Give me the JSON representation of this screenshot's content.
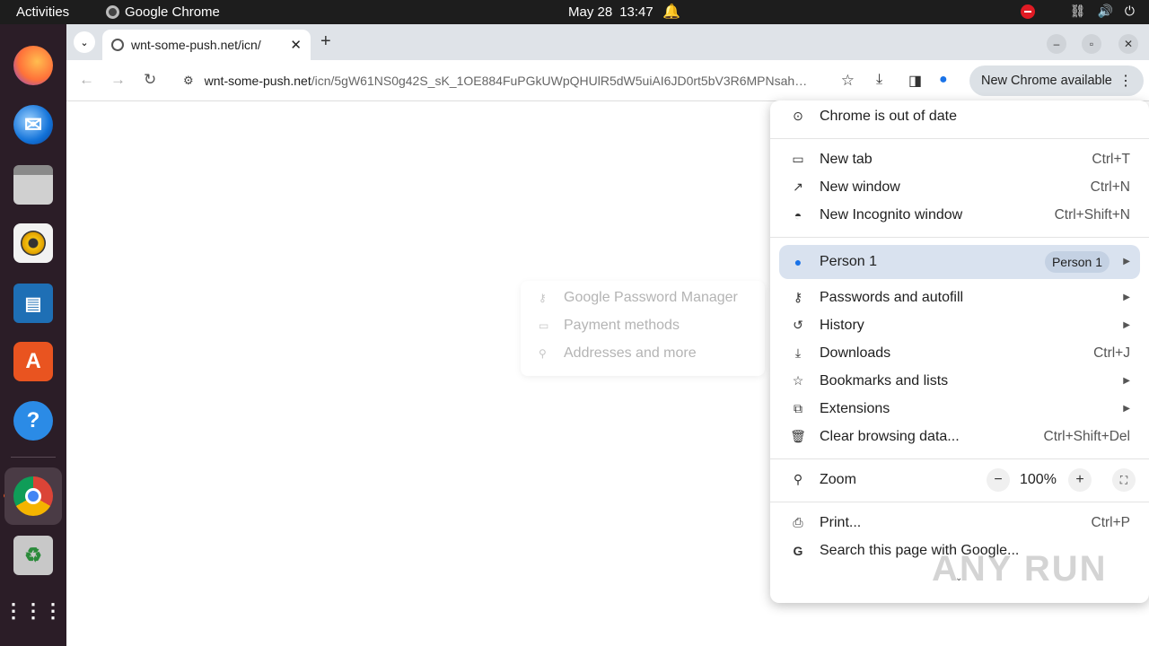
{
  "topbar": {
    "activities": "Activities",
    "app_name": "Google Chrome",
    "date": "May 28",
    "time": "13:47"
  },
  "dock": {
    "apps": [
      "firefox-icon",
      "thunderbird-icon",
      "files-icon",
      "rhythmbox-icon",
      "libreoffice-writer-icon",
      "app-center-icon",
      "help-icon",
      "chrome-icon",
      "trash-icon",
      "show-apps-icon"
    ]
  },
  "tab": {
    "title": "wnt-some-push.net/icn/"
  },
  "address": {
    "host": "wnt-some-push.net",
    "path": "/icn/5gW61NS0g42S_sK_1OE884FuPGkUWpQHUlR5dW5uiAI6JD0rt5bV3R6MPNsahdf..."
  },
  "update_button": "New Chrome available",
  "autofill_submenu": {
    "items": [
      "Google Password Manager",
      "Payment methods",
      "Addresses and more"
    ]
  },
  "menu": {
    "out_of_date": "Chrome is out of date",
    "new_tab": {
      "label": "New tab",
      "shortcut": "Ctrl+T"
    },
    "new_window": {
      "label": "New window",
      "shortcut": "Ctrl+N"
    },
    "incognito": {
      "label": "New Incognito window",
      "shortcut": "Ctrl+Shift+N"
    },
    "profile": {
      "label": "Person 1",
      "pill": "Person 1"
    },
    "passwords": "Passwords and autofill",
    "history": "History",
    "downloads": {
      "label": "Downloads",
      "shortcut": "Ctrl+J"
    },
    "bookmarks": "Bookmarks and lists",
    "extensions": "Extensions",
    "clear": {
      "label": "Clear browsing data...",
      "shortcut": "Ctrl+Shift+Del"
    },
    "zoom": {
      "label": "Zoom",
      "value": "100%",
      "minus": "−",
      "plus": "+"
    },
    "print": {
      "label": "Print...",
      "shortcut": "Ctrl+P"
    },
    "search_page": "Search this page with Google..."
  },
  "watermark": "ANY RUN"
}
